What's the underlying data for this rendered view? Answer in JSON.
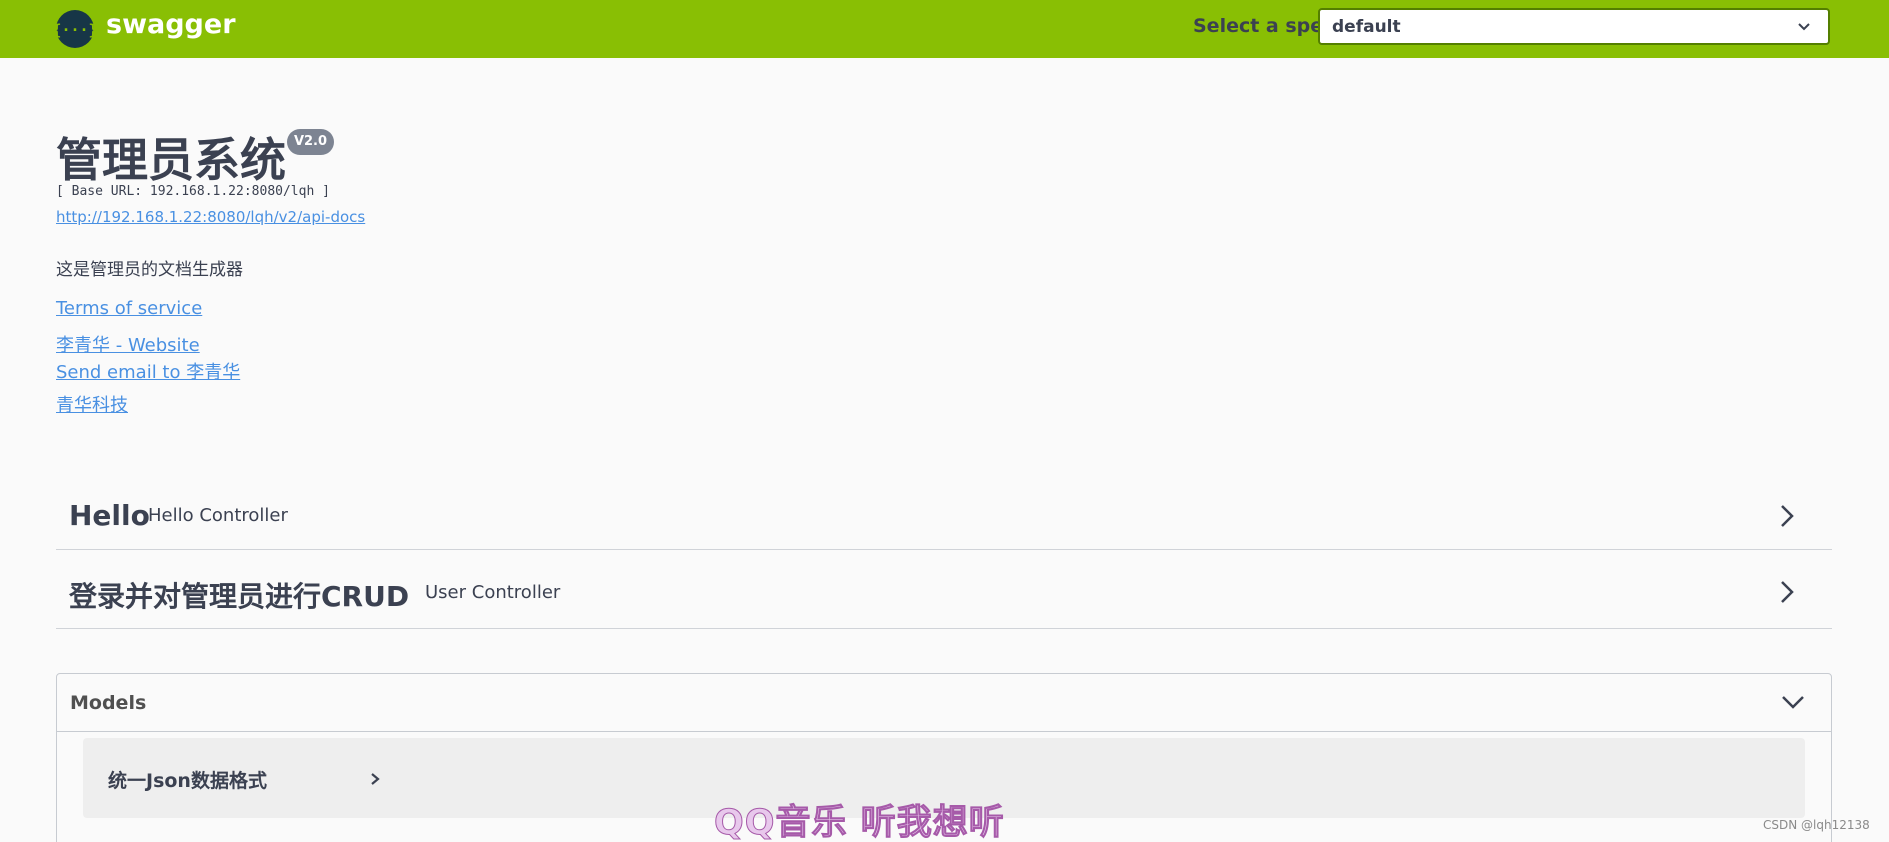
{
  "topbar": {
    "logo_text": "swagger",
    "spec_label": "Select a spec",
    "spec_value": "default"
  },
  "info": {
    "title": "管理员系统",
    "version": "V2.0",
    "base_url": "[ Base URL: 192.168.1.22:8080/lqh ]",
    "api_docs_link": "http://192.168.1.22:8080/lqh/v2/api-docs",
    "description": "这是管理员的文档生成器",
    "links": {
      "terms": "Terms of service",
      "website": "李青华 - Website",
      "email": "Send email to 李青华",
      "license": "青华科技"
    }
  },
  "tags": [
    {
      "name": "Hello",
      "description": "Hello Controller"
    },
    {
      "name": "登录并对管理员进行CRUD",
      "description": "User Controller"
    }
  ],
  "models": {
    "title": "Models",
    "items": [
      {
        "name": "统一Json数据格式"
      }
    ]
  },
  "overlay": {
    "watermark": "QQ音乐 听我想听",
    "credit": "CSDN @lqh12138"
  },
  "colors": {
    "topbar": "#89bf04",
    "link": "#4990e2",
    "text": "#3b4151",
    "badge": "#7d8492"
  }
}
